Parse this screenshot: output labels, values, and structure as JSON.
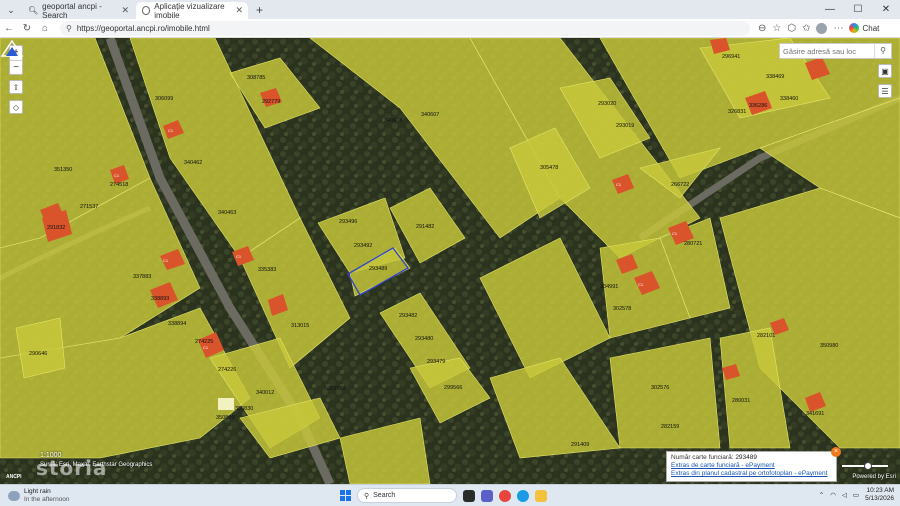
{
  "browser": {
    "tabs": [
      {
        "title": "geoportal ancpi - Search",
        "active": false
      },
      {
        "title": "Aplicaţie vizualizare imobile",
        "active": true
      }
    ],
    "url": "https://geoportal.ancpi.ro/imobile.html",
    "chat_label": "Chat"
  },
  "map": {
    "search_placeholder": "Găsire adresă sau loc",
    "scale": "1:1000",
    "attribution": "Sursă: Esri, Maxar, Earthstar Geographics",
    "watermark": "storia",
    "logo_text": "ANCPI",
    "powered_by": "Powered by Esri",
    "parcel_labels": [
      {
        "id": "293489",
        "selected": true
      },
      {
        "id": "293496"
      },
      {
        "id": "293492"
      },
      {
        "id": "291482"
      },
      {
        "id": "293482"
      },
      {
        "id": "293480"
      },
      {
        "id": "293479"
      },
      {
        "id": "299566"
      },
      {
        "id": "340608"
      },
      {
        "id": "340607"
      },
      {
        "id": "340462"
      },
      {
        "id": "340463"
      },
      {
        "id": "351350"
      },
      {
        "id": "271537"
      },
      {
        "id": "274518"
      },
      {
        "id": "291832"
      },
      {
        "id": "306099"
      },
      {
        "id": "308785"
      },
      {
        "id": "292779"
      },
      {
        "id": "305478"
      },
      {
        "id": "293020"
      },
      {
        "id": "293019"
      },
      {
        "id": "266722"
      },
      {
        "id": "296941"
      },
      {
        "id": "338469"
      },
      {
        "id": "336286"
      },
      {
        "id": "338460"
      },
      {
        "id": "326831"
      },
      {
        "id": "280721"
      },
      {
        "id": "334991"
      },
      {
        "id": "302578"
      },
      {
        "id": "335383"
      },
      {
        "id": "337883"
      },
      {
        "id": "338893"
      },
      {
        "id": "338894"
      },
      {
        "id": "313015"
      },
      {
        "id": "274225"
      },
      {
        "id": "274226"
      },
      {
        "id": "290646"
      },
      {
        "id": "340012"
      },
      {
        "id": "350830"
      },
      {
        "id": "350829"
      },
      {
        "id": "283779"
      },
      {
        "id": "282101"
      },
      {
        "id": "350980"
      },
      {
        "id": "302576"
      },
      {
        "id": "280031"
      },
      {
        "id": "282159"
      },
      {
        "id": "341691"
      },
      {
        "id": "291409"
      }
    ]
  },
  "popup": {
    "cf_label": "Număr carte funciară:",
    "cf_value": "293489",
    "link1": "Extras de carte funciară - ePayment",
    "link2": "Extras din planul cadastral pe ortofotoplan - ePayment"
  },
  "taskbar": {
    "weather_title": "Light rain",
    "weather_sub": "In the afternoon",
    "search_label": "Search",
    "time": "10:23 AM",
    "date": "5/13/2026"
  },
  "colors": {
    "parcel_fill": "#c8c83a",
    "selected_outline": "#3344cc",
    "building_fill": "#d9532b",
    "popup_close": "#f07a1a"
  }
}
